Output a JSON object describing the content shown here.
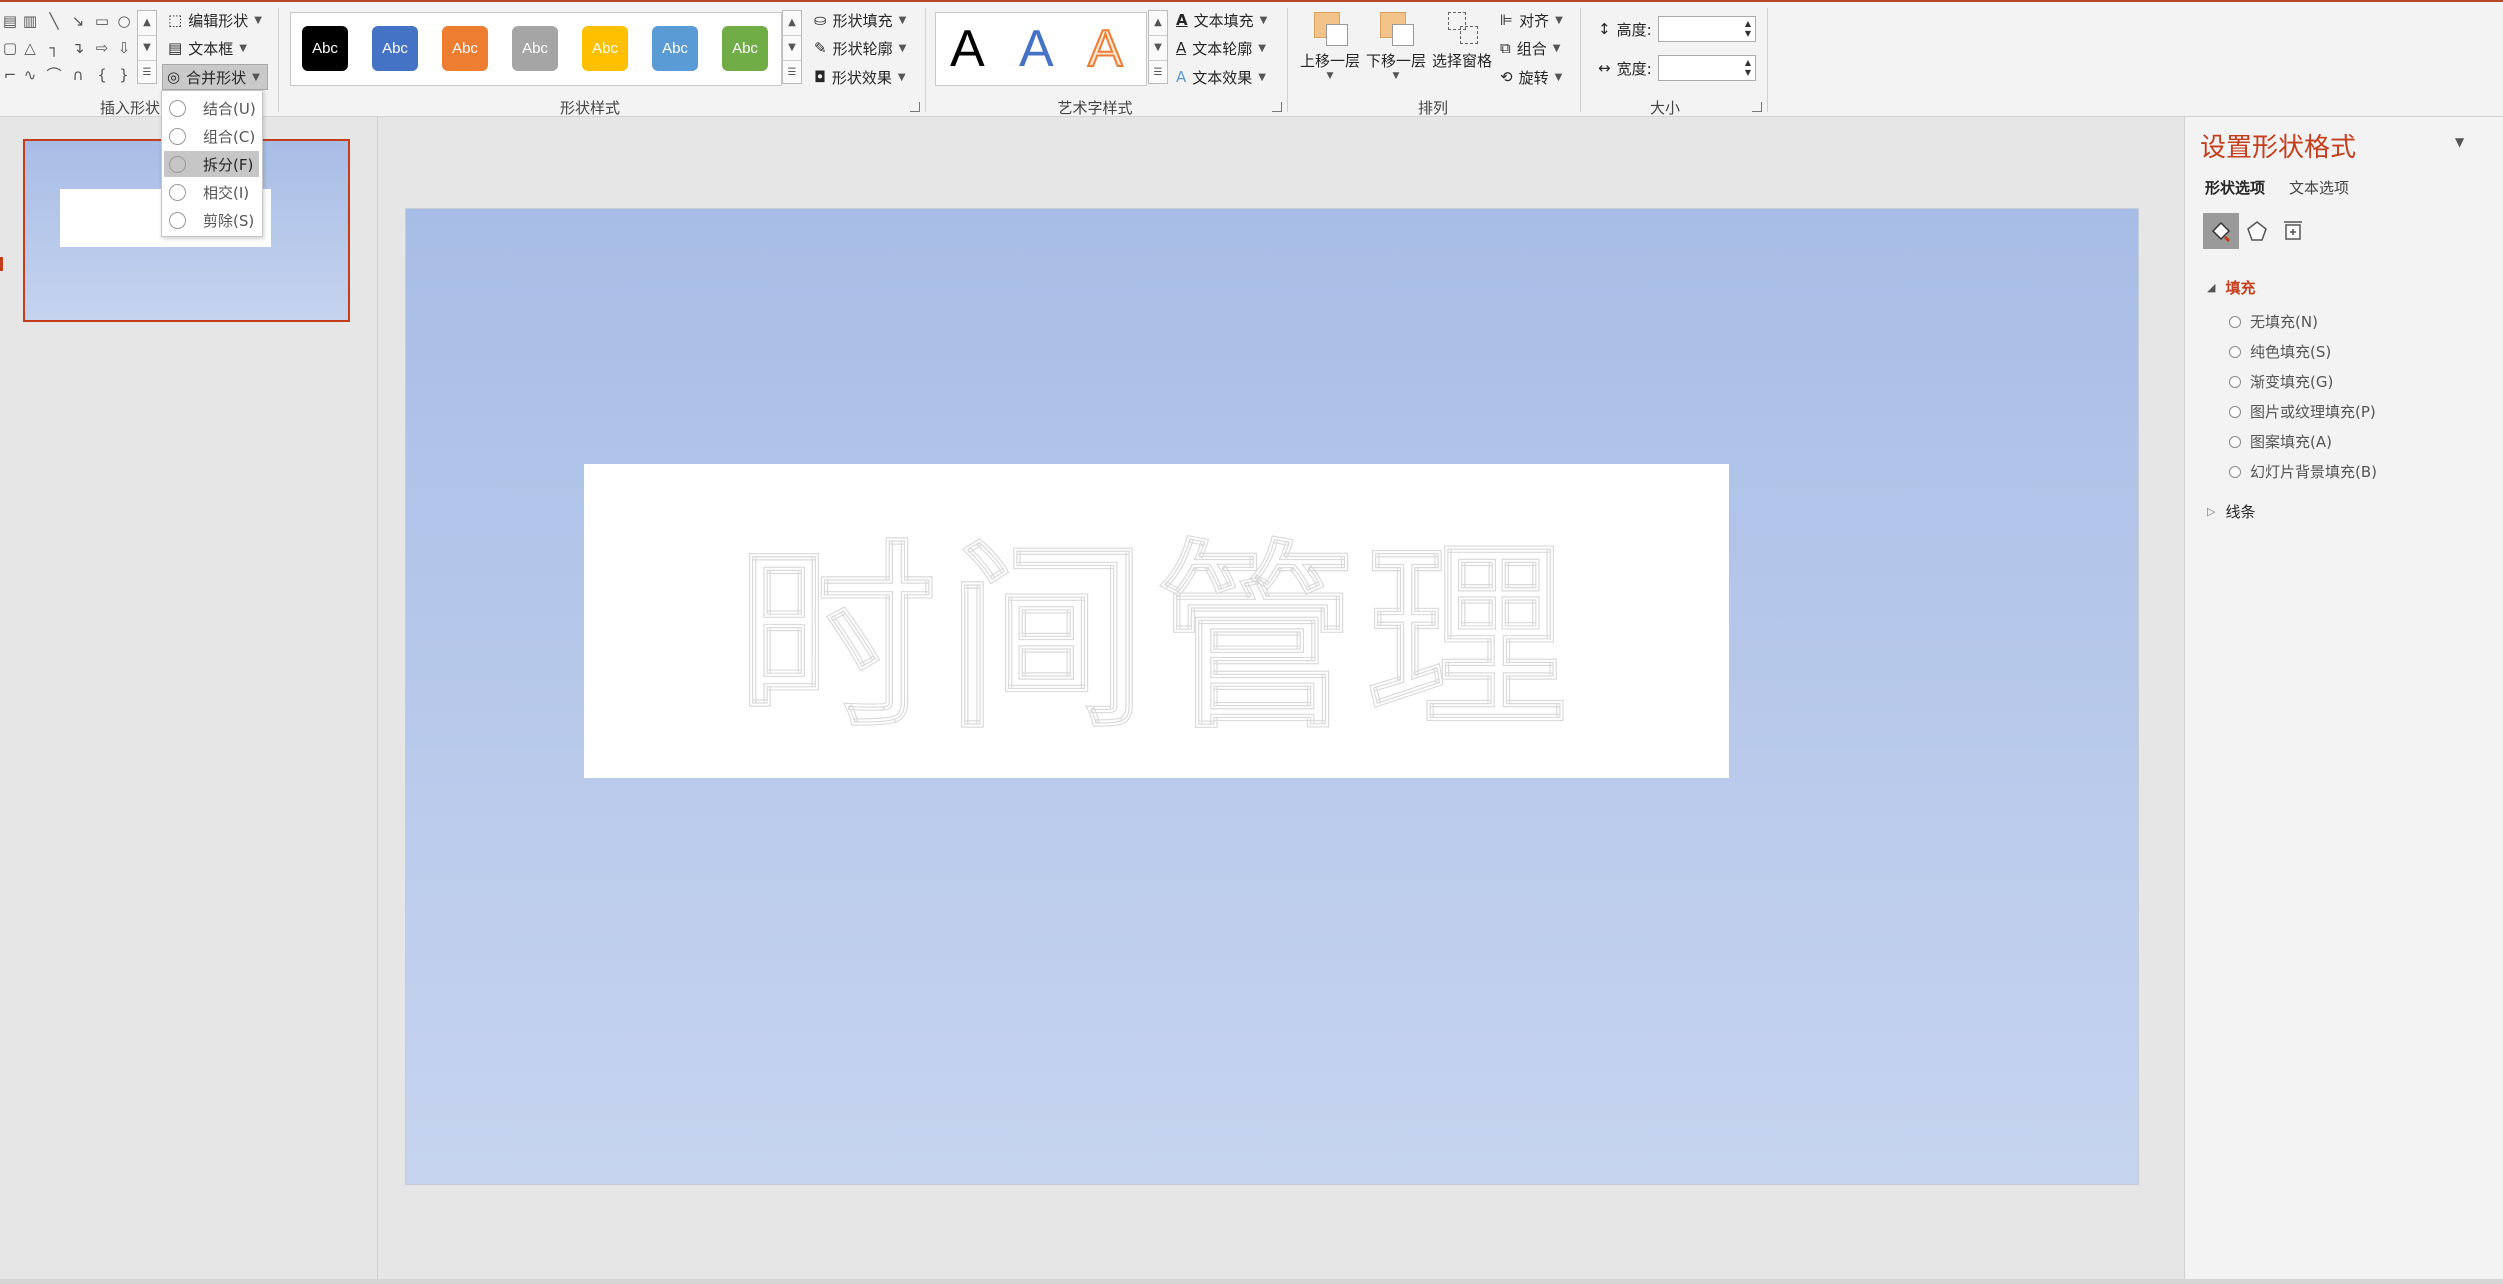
{
  "ribbon": {
    "groups": {
      "insert_shapes": "插入形状",
      "shape_styles": "形状样式",
      "wordart_styles": "艺术字样式",
      "arrange": "排列",
      "size": "大小"
    },
    "insert_shapes": {
      "edit_shape": "编辑形状",
      "text_box": "文本框",
      "merge_shapes": "合并形状"
    },
    "shape_styles": {
      "swatches": [
        {
          "label": "Abc",
          "bg": "#000000"
        },
        {
          "label": "Abc",
          "bg": "#4472c4"
        },
        {
          "label": "Abc",
          "bg": "#ed7d31"
        },
        {
          "label": "Abc",
          "bg": "#a5a5a5"
        },
        {
          "label": "Abc",
          "bg": "#ffc000"
        },
        {
          "label": "Abc",
          "bg": "#5b9bd5"
        },
        {
          "label": "Abc",
          "bg": "#70ad47"
        }
      ],
      "shape_fill": "形状填充",
      "shape_outline": "形状轮廓",
      "shape_effects": "形状效果"
    },
    "wordart": {
      "samples": [
        "A",
        "A",
        "A"
      ],
      "text_fill": "文本填充",
      "text_outline": "文本轮廓",
      "text_effects": "文本效果"
    },
    "arrange": {
      "bring_forward": "上移一层",
      "send_backward": "下移一层",
      "selection_pane": "选择窗格",
      "align": "对齐",
      "group": "组合",
      "rotate": "旋转"
    },
    "size": {
      "height_label": "高度:",
      "width_label": "宽度:",
      "height_value": "",
      "width_value": ""
    }
  },
  "merge_menu": {
    "items": [
      "结合(U)",
      "组合(C)",
      "拆分(F)",
      "相交(I)",
      "剪除(S)"
    ],
    "hovered_index": 2
  },
  "slide": {
    "text": "时间管理"
  },
  "format_pane": {
    "title": "设置形状格式",
    "tabs": [
      "形状选项",
      "文本选项"
    ],
    "fill_section": "填充",
    "fill_options": [
      "无填充(N)",
      "纯色填充(S)",
      "渐变填充(G)",
      "图片或纹理填充(P)",
      "图案填充(A)",
      "幻灯片背景填充(B)"
    ],
    "line_section": "线条"
  },
  "colors": {
    "accent": "#c43e1c",
    "slide_bg_top": "#a8bde6",
    "slide_bg_bottom": "#c6d4ef"
  }
}
